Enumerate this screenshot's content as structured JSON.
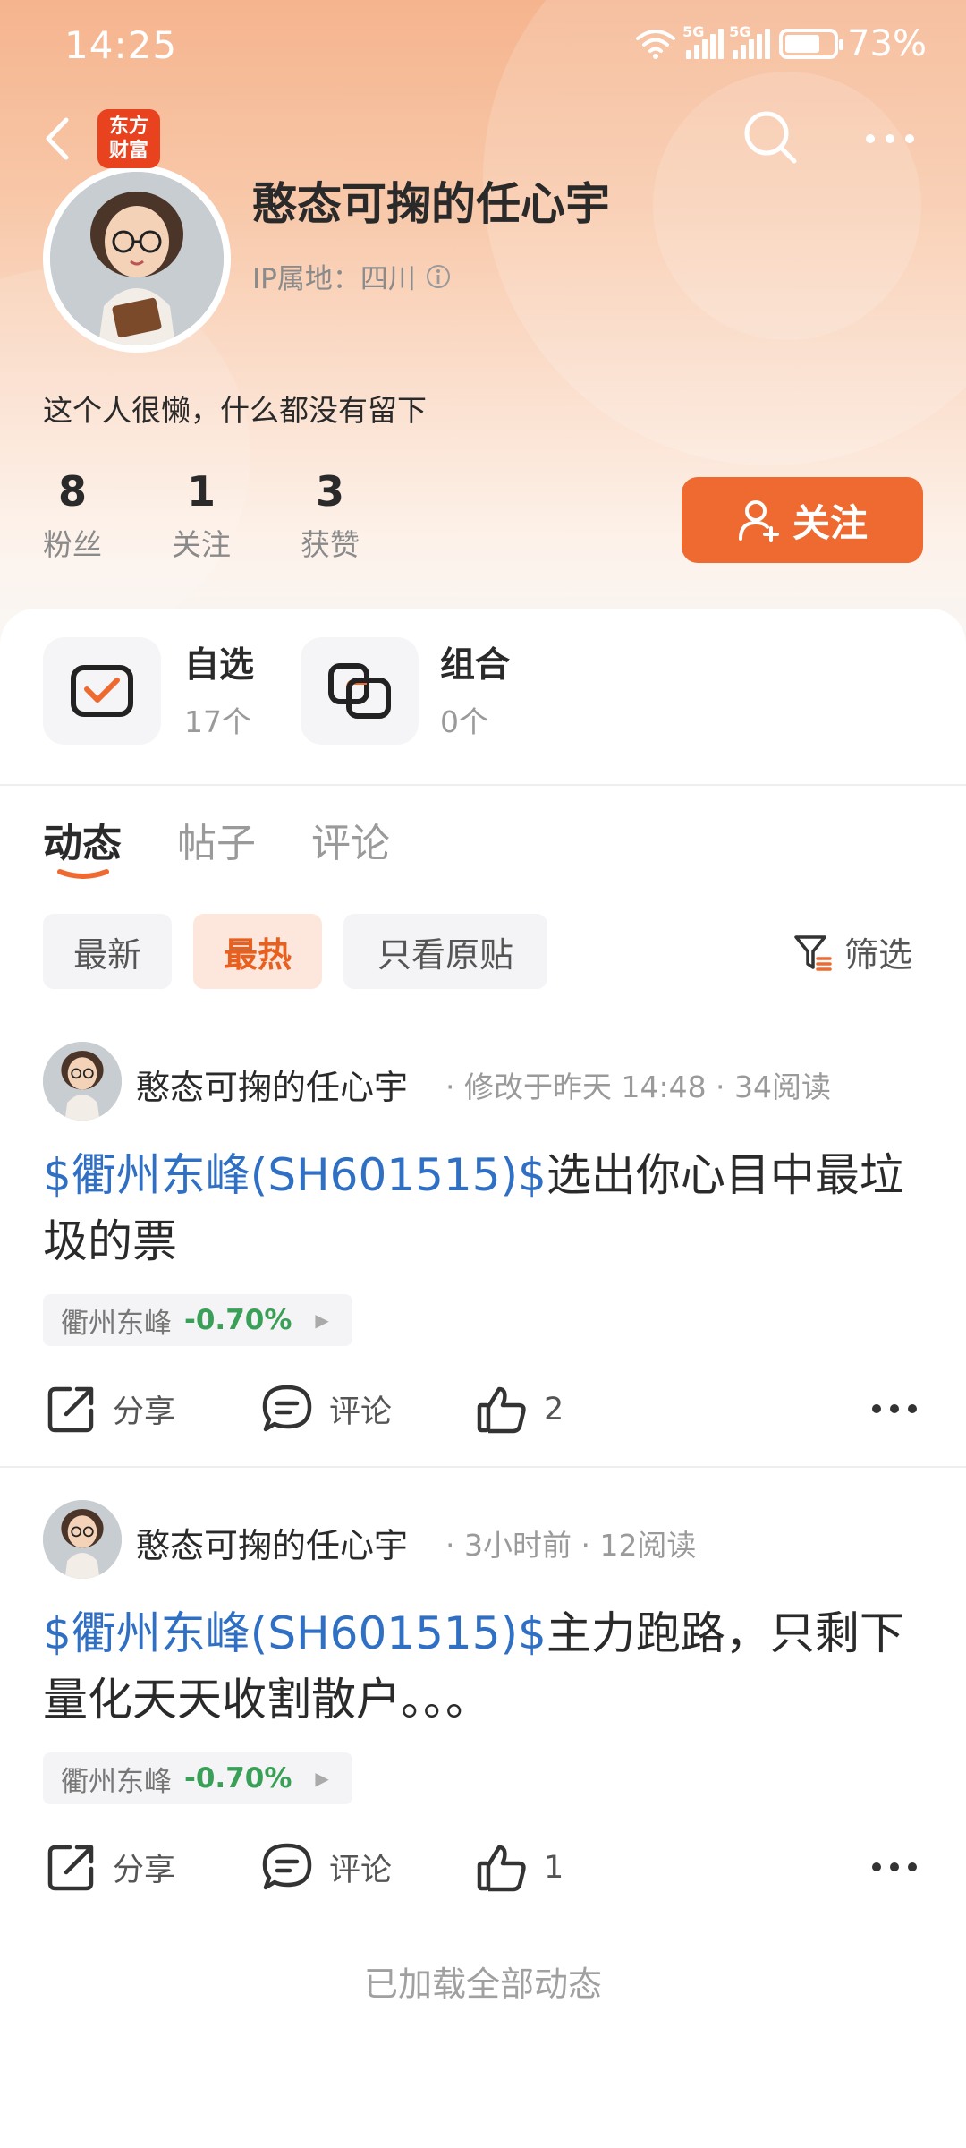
{
  "status_bar": {
    "time": "14:25",
    "net_tag_1": "5G",
    "net_tag_2": "5G",
    "battery": "73%"
  },
  "brand": {
    "line1": "东方",
    "line2": "财富"
  },
  "profile": {
    "username": "憨态可掬的任心宇",
    "ip_label": "IP属地：四川",
    "bio": "这个人很懒，什么都没有留下",
    "stats": [
      {
        "num": "8",
        "label": "粉丝"
      },
      {
        "num": "1",
        "label": "关注"
      },
      {
        "num": "3",
        "label": "获赞"
      }
    ],
    "follow_label": "关注"
  },
  "shortcuts": [
    {
      "title": "自选",
      "count": "17个"
    },
    {
      "title": "组合",
      "count": "0个"
    }
  ],
  "tabs": [
    "动态",
    "帖子",
    "评论"
  ],
  "chips": [
    "最新",
    "最热",
    "只看原贴"
  ],
  "filter_label": "筛选",
  "posts": [
    {
      "author": "憨态可掬的任心宇",
      "meta": "· 修改于昨天 14:48 · 34阅读",
      "stock_link": "$衢州东峰(SH601515)$",
      "text": "选出你心目中最垃圾的票",
      "stock_name": "衢州东峰",
      "stock_change": "-0.70%",
      "share_label": "分享",
      "comment_label": "评论",
      "likes": "2"
    },
    {
      "author": "憨态可掬的任心宇",
      "meta": "· 3小时前 · 12阅读",
      "stock_link": "$衢州东峰(SH601515)$",
      "text": "主力跑路，只剩下量化天天收割散户。。。",
      "stock_name": "衢州东峰",
      "stock_change": "-0.70%",
      "share_label": "分享",
      "comment_label": "评论",
      "likes": "1"
    }
  ],
  "footer": "已加载全部动态",
  "colors": {
    "accent": "#ee6a30",
    "link": "#2f6fc4",
    "down": "#3aa057"
  },
  "icons": [
    "back-icon",
    "search-icon",
    "more-icon",
    "info-icon",
    "add-user-icon",
    "watchlist-icon",
    "portfolio-icon",
    "filter-icon",
    "share-icon",
    "comment-icon",
    "like-icon"
  ]
}
